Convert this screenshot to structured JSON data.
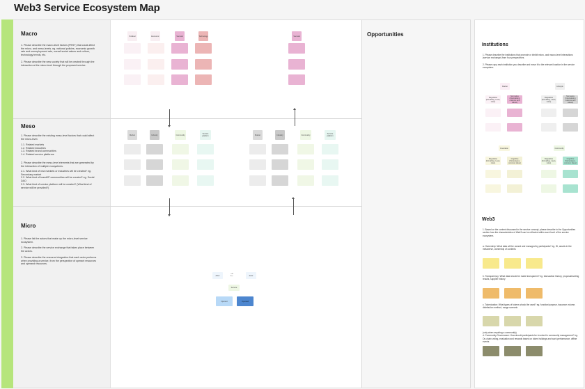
{
  "title": "Web3 Service Ecosystem Map",
  "macro": {
    "title": "Macro",
    "desc1": "1. Please describe the macro-level factors (PEST) that could affect the micro- and meso-levels. eg. national policies, economic growth rate and unemployment rate, overall social values and culture, technology trends, etc.",
    "desc2": "2. Please describe the new society that will be created through the interaction at the micro-level through the proposed service.",
    "labels": [
      "Political",
      "Economic",
      "Societal",
      "Technology"
    ],
    "right_label": "Societal"
  },
  "meso": {
    "title": "Meso",
    "desc1": "1. Please describe the existing meso-level factors that could affect the micro-level.",
    "list": "1.1. Related markets\n1.2. Related industries\n1.3. Related brand communities\n1.4. Related service platforms",
    "desc2": "2. Please describe the meso-level elements that are generated by the interaction of multiple ecosystems.",
    "list2": "2.1. What kind of new markets or industries will be created? eg. Secondary market\n2.2. What kind of brand/IP communities will be created? eg. Social DAO\n2.3. What kind of service platform will be created? (What kind of service will be provided?)",
    "labels": [
      "Market",
      "Industry",
      "Community",
      "Service platform"
    ]
  },
  "micro": {
    "title": "Micro",
    "desc1": "1. Please list the actors that make up the micro-level service ecosystem.",
    "desc2": "2. Please describe the service exchange that takes place between the actors.",
    "desc3": "3. Please describe the resource integration that each actor performs when providing a service, from the perspective of operant resources and operand resources.",
    "actor_left": "Actor",
    "actor_right": "Actor",
    "service": "Service",
    "op1": "Operant",
    "op2": "Operand"
  },
  "opportunities": {
    "title": "Opportunities"
  },
  "institutions": {
    "title": "Institutions",
    "desc1": "1. Please describe the institutions that promote or inhibit micro- and macro-level interactions (service exchange) from four perspectives.",
    "desc2": "2. Please copy each institution you describe and move it to the relevant location in the service ecosystem.",
    "q1": "Market",
    "q2": "Lifestyle",
    "q3": "Innovation",
    "q4": "Community",
    "sub1": "Regulative (formal/leg, Laws, rules)",
    "sub2": "Normative (Internalising customs and values)",
    "sub3": "Cognitive (Stereotypes, common ideas)"
  },
  "web3": {
    "title": "Web3",
    "desc1": "1. Based on the content discussed in the service concept, please describe in the Opportunities section how the characteristics of Web3 can be reflected within each level of the service ecosystem.",
    "a": "a. Ownership: What data will be owned and managed by participants? eg. ID, assets in the metaverse, ownership of contents",
    "b": "b. Transparency: What data should be made transparent? eg. transaction history, proposals/voting results, supplier history",
    "c": "c. Tokenization: What types of tokens should be used? eg. function/purpose, issuance volume, distribution method, usage scenario",
    "d": "(only when requiring a community)\nd. Community Governance: How should participants be involved in community management? eg. On-chain voting, evaluation and rewards based on token holdings and work performance, offline events"
  },
  "colors": {
    "green": "#b6e57c",
    "pink_light": "#f8eef2",
    "pink": "#e9b3d3",
    "salmon": "#ecb5b5",
    "gray": "#d6d6d6",
    "gray_light": "#ececec",
    "green_light": "#eef7e4",
    "mint": "#e6f6f1",
    "blue_light": "#b8d9f7",
    "blue": "#4d86cf",
    "yellow": "#f8e98c",
    "orange": "#efbb6a",
    "olive_light": "#d8d7ab",
    "olive": "#8c8c6c"
  }
}
